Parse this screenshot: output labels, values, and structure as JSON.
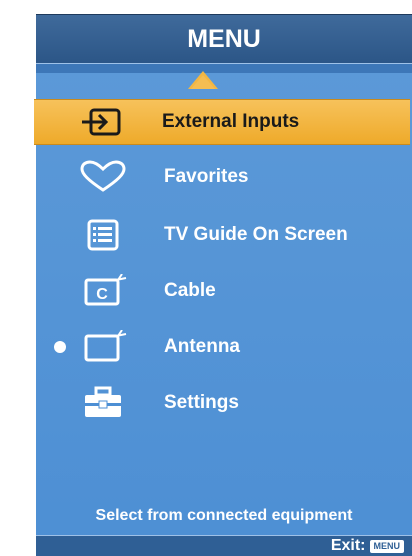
{
  "menu": {
    "title": "MENU",
    "items": [
      {
        "label": "External Inputs",
        "icon": "input-icon",
        "selected": true,
        "bullet": false
      },
      {
        "label": "Favorites",
        "icon": "heart-icon",
        "selected": false,
        "bullet": false
      },
      {
        "label": "TV Guide On Screen",
        "icon": "guide-icon",
        "selected": false,
        "bullet": false
      },
      {
        "label": "Cable",
        "icon": "cable-icon",
        "selected": false,
        "bullet": false
      },
      {
        "label": "Antenna",
        "icon": "antenna-icon",
        "selected": false,
        "bullet": true
      },
      {
        "label": "Settings",
        "icon": "toolbox-icon",
        "selected": false,
        "bullet": false
      }
    ],
    "hint": "Select from connected equipment",
    "exit_label": "Exit:",
    "exit_key": "MENU"
  },
  "colors": {
    "panel": "#4d8fd4",
    "header": "#2c5687",
    "selected": "#f2b643",
    "text": "#ffffff"
  }
}
